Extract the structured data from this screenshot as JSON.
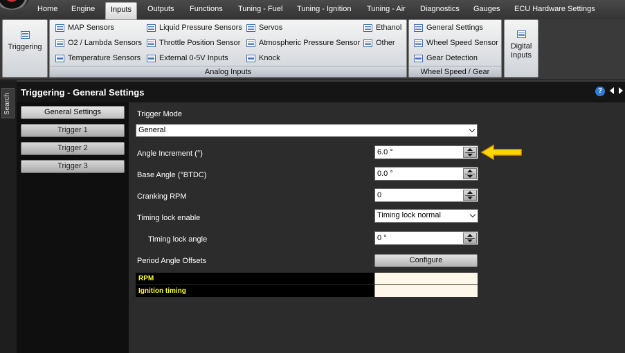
{
  "menu": {
    "items": [
      "Home",
      "Engine",
      "Inputs",
      "Outputs",
      "Functions",
      "Tuning - Fuel",
      "Tuning - Ignition",
      "Tuning - Air",
      "Diagnostics",
      "Gauges",
      "ECU Hardware Settings"
    ],
    "active": "Inputs"
  },
  "ribbon": {
    "triggering": "Triggering",
    "analog": {
      "label": "Analog Inputs",
      "items": [
        "MAP Sensors",
        "O2 / Lambda Sensors",
        "Temperature Sensors",
        "Liquid Pressure Sensors",
        "Throttle Position Sensor",
        "External 0-5V Inputs",
        "Servos",
        "Atmospheric Pressure Sensor",
        "Knock",
        "Ethanol",
        "Other"
      ]
    },
    "wheel": {
      "label": "Wheel Speed / Gear",
      "items": [
        "General Settings",
        "Wheel Speed Sensor",
        "Gear Detection"
      ]
    },
    "digital": "Digital Inputs"
  },
  "side": {
    "search": "Search"
  },
  "panel": {
    "title": "Triggering - General Settings",
    "help": "?",
    "tabs": [
      "General Settings",
      "Trigger 1",
      "Trigger 2",
      "Trigger 3"
    ]
  },
  "form": {
    "trigger_mode_label": "Trigger Mode",
    "trigger_mode_value": "General",
    "angle_increment_label": "Angle Increment (°)",
    "angle_increment_value": "6.0 °",
    "base_angle_label": "Base Angle (°BTDC)",
    "base_angle_value": "0.0 °",
    "cranking_rpm_label": "Cranking RPM",
    "cranking_rpm_value": "0",
    "timing_lock_enable_label": "Timing lock enable",
    "timing_lock_enable_value": "Timing lock normal",
    "timing_lock_angle_label": "Timing lock angle",
    "timing_lock_angle_value": "0 °",
    "period_offsets_label": "Period Angle Offsets",
    "configure_label": "Configure",
    "table_rows": [
      "RPM",
      "Ignition timing"
    ]
  },
  "colors": {
    "pointer": "#ffd700",
    "table_key": "#ffff33"
  }
}
